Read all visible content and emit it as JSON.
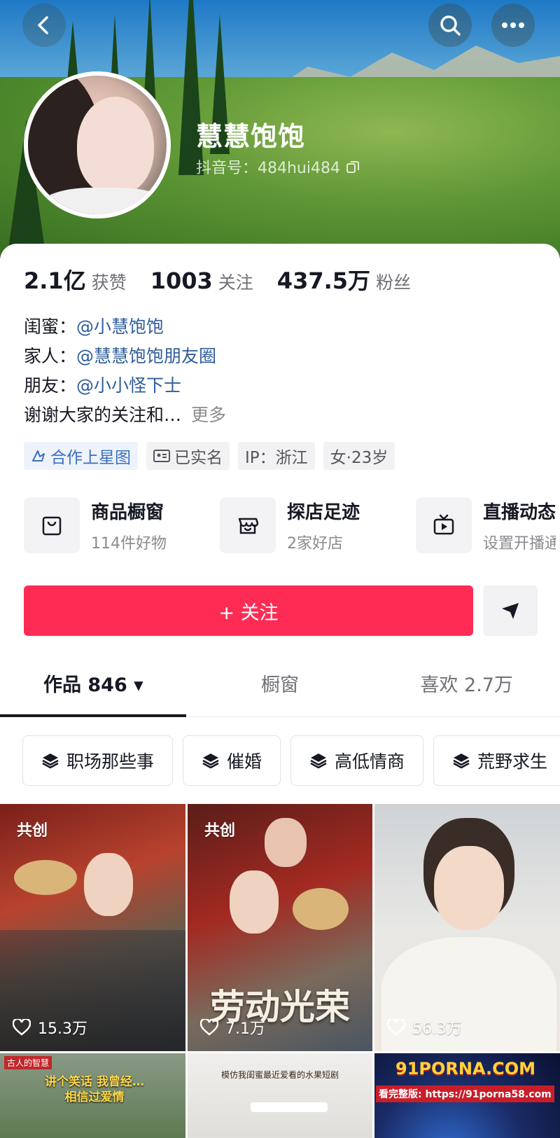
{
  "header": {
    "back_icon": "chevron-left-icon",
    "search_icon": "search-icon",
    "more_icon": "more-horizontal-icon"
  },
  "profile": {
    "nickname": "慧慧饱饱",
    "douyin_id": "抖音号：484hui484"
  },
  "stats": [
    {
      "num": "2.1亿",
      "label": "获赞"
    },
    {
      "num": "1003",
      "label": "关注"
    },
    {
      "num": "437.5万",
      "label": "粉丝"
    }
  ],
  "bio": {
    "line1_label": "闺蜜：",
    "line1_mention": "@小慧饱饱",
    "line2_label": "家人：",
    "line2_mention": "@慧慧饱饱朋友圈",
    "line3_label": "朋友：",
    "line3_mention": "@小小怪下士",
    "line4_text": "谢谢大家的关注和…",
    "more": "更多"
  },
  "tags": [
    {
      "text": "合作上星图",
      "icon": "star-chart-icon"
    },
    {
      "text": "已实名",
      "icon": "id-card-icon"
    },
    {
      "text": "IP：浙江",
      "icon": ""
    },
    {
      "text": "女·23岁",
      "icon": ""
    }
  ],
  "features": [
    {
      "title": "商品橱窗",
      "sub": "114件好物",
      "icon": "shopping-bag-icon"
    },
    {
      "title": "探店足迹",
      "sub": "2家好店",
      "icon": "store-icon"
    },
    {
      "title": "直播动态",
      "sub": "设置开播通",
      "icon": "tv-icon"
    }
  ],
  "actions": {
    "follow": "+ 关注",
    "share_icon": "send-icon"
  },
  "tabs": [
    {
      "label": "作品 846 ▾",
      "active": true
    },
    {
      "label": "橱窗",
      "active": false
    },
    {
      "label": "喜欢 2.7万",
      "active": false
    }
  ],
  "collections": [
    "职场那些事",
    "催婚",
    "高低情商",
    "荒野求生"
  ],
  "videos": [
    {
      "badge": "共创",
      "likes": "15.3万"
    },
    {
      "badge": "共创",
      "likes": "7.1万",
      "overlay": "劳动光荣"
    },
    {
      "badge": "",
      "likes": "56.3万"
    },
    {
      "caption_top": "古人的智慧",
      "caption": "讲个笑话 我曾经… 相信过爱情"
    },
    {
      "caption": "模仿我闺蜜最近爱看的水果短剧"
    },
    {
      "caption": "91PORNA.COM",
      "caption2": "看完整版: https://91porna58.com"
    }
  ],
  "colors": {
    "accent": "#fe2c55",
    "mention": "#2f5c9b"
  }
}
